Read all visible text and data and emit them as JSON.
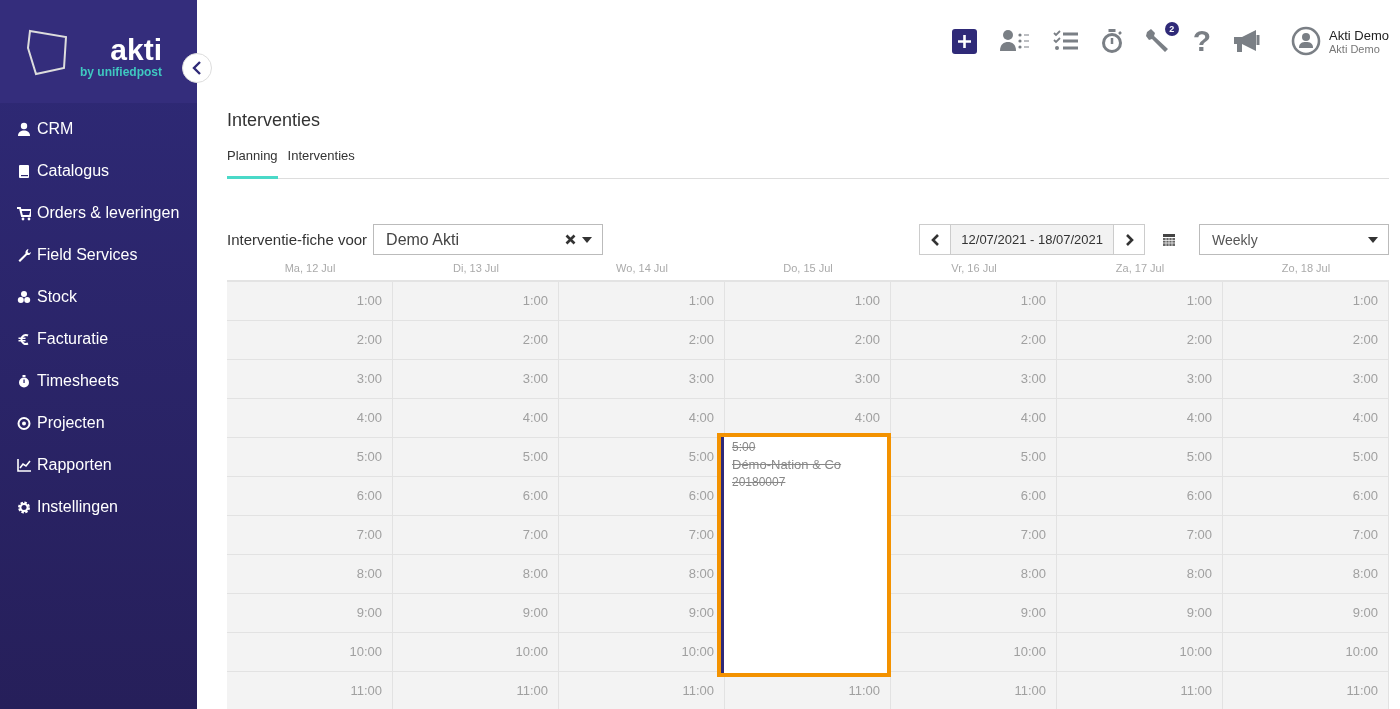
{
  "sidebar": {
    "logo": {
      "name": "akti",
      "tagline": "by unifiedpost"
    },
    "items": [
      {
        "label": "CRM"
      },
      {
        "label": "Catalogus"
      },
      {
        "label": "Orders & leveringen"
      },
      {
        "label": "Field Services"
      },
      {
        "label": "Stock"
      },
      {
        "label": "Facturatie"
      },
      {
        "label": "Timesheets"
      },
      {
        "label": "Projecten"
      },
      {
        "label": "Rapporten"
      },
      {
        "label": "Instellingen"
      }
    ]
  },
  "topbar": {
    "help": "?",
    "tools_badge": "2",
    "user": {
      "name": "Akti Demo",
      "company": "Akti Demo"
    }
  },
  "page": {
    "title": "Interventies",
    "tabs": [
      {
        "label": "Planning",
        "selected": true
      },
      {
        "label": "Interventies",
        "selected": false
      }
    ]
  },
  "toolbar": {
    "filter_label": "Interventie-fiche voor",
    "filter_value": "Demo Akti",
    "date_range": "12/07/2021 - 18/07/2021",
    "view": "Weekly"
  },
  "calendar": {
    "days": [
      "Ma, 12 Jul",
      "Di, 13 Jul",
      "Wo, 14 Jul",
      "Do, 15 Jul",
      "Vr, 16 Jul",
      "Za, 17 Jul",
      "Zo, 18 Jul"
    ],
    "rows": [
      [
        {
          "hour": "1:00"
        },
        {
          "hour": "1:00"
        },
        {
          "hour": "1:00"
        },
        {
          "hour": "1:00"
        },
        {
          "hour": "1:00"
        },
        {
          "hour": "1:00"
        },
        {
          "hour": "1:00"
        }
      ],
      [
        {
          "hour": "2:00"
        },
        {
          "hour": "2:00"
        },
        {
          "hour": "2:00"
        },
        {
          "hour": "2:00"
        },
        {
          "hour": "2:00"
        },
        {
          "hour": "2:00"
        },
        {
          "hour": "2:00"
        }
      ],
      [
        {
          "hour": "3:00"
        },
        {
          "hour": "3:00"
        },
        {
          "hour": "3:00"
        },
        {
          "hour": "3:00"
        },
        {
          "hour": "3:00"
        },
        {
          "hour": "3:00"
        },
        {
          "hour": "3:00"
        }
      ],
      [
        {
          "hour": "4:00"
        },
        {
          "hour": "4:00"
        },
        {
          "hour": "4:00"
        },
        {
          "hour": "4:00"
        },
        {
          "hour": "4:00"
        },
        {
          "hour": "4:00"
        },
        {
          "hour": "4:00"
        }
      ],
      [
        {
          "hour": "5:00"
        },
        {
          "hour": "5:00"
        },
        {
          "hour": "5:00"
        },
        {
          "event": {
            "time": "5:00",
            "title": "Démo-Nation & Co",
            "number": "20180007",
            "cancelled": true,
            "selected": true
          }
        },
        {
          "hour": "5:00"
        },
        {
          "hour": "5:00"
        },
        {
          "hour": "5:00"
        }
      ],
      [
        {
          "hour": "6:00"
        },
        {
          "hour": "6:00"
        },
        {
          "hour": "6:00"
        },
        {},
        {
          "hour": "6:00"
        },
        {
          "hour": "6:00"
        },
        {
          "hour": "6:00"
        }
      ],
      [
        {
          "hour": "7:00"
        },
        {
          "hour": "7:00"
        },
        {
          "hour": "7:00"
        },
        {},
        {
          "hour": "7:00"
        },
        {
          "hour": "7:00"
        },
        {
          "hour": "7:00"
        }
      ],
      [
        {
          "hour": "8:00"
        },
        {
          "hour": "8:00"
        },
        {
          "hour": "8:00"
        },
        {},
        {
          "hour": "8:00"
        },
        {
          "hour": "8:00"
        },
        {
          "hour": "8:00"
        }
      ],
      [
        {
          "hour": "9:00"
        },
        {
          "hour": "9:00"
        },
        {
          "hour": "9:00"
        },
        {},
        {
          "hour": "9:00"
        },
        {
          "hour": "9:00"
        },
        {
          "hour": "9:00"
        }
      ],
      [
        {
          "hour": "10:00"
        },
        {
          "hour": "10:00"
        },
        {
          "hour": "10:00"
        },
        {},
        {
          "hour": "10:00"
        },
        {
          "hour": "10:00"
        },
        {
          "hour": "10:00"
        }
      ],
      [
        {
          "hour": "11:00"
        },
        {
          "hour": "11:00"
        },
        {
          "hour": "11:00"
        },
        {
          "hour": "11:00"
        },
        {
          "hour": "11:00"
        },
        {
          "hour": "11:00"
        },
        {
          "hour": "11:00"
        }
      ]
    ]
  }
}
